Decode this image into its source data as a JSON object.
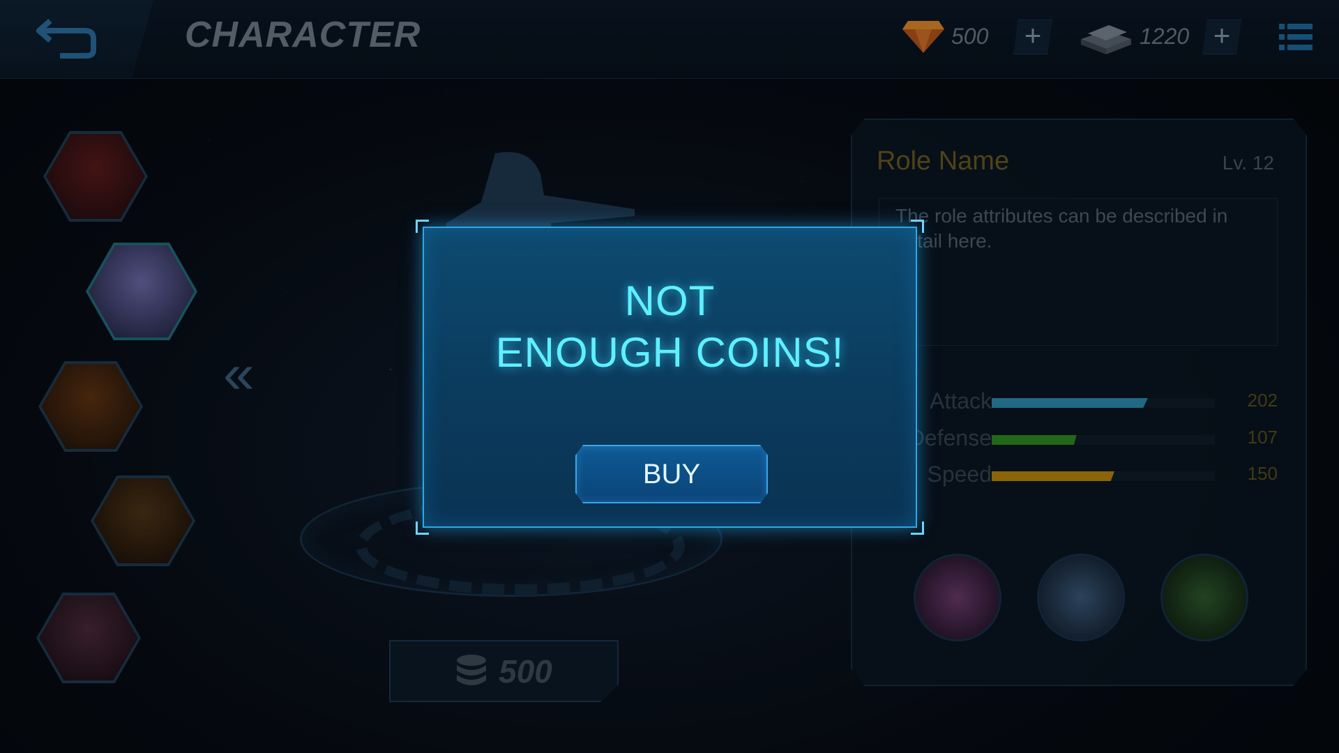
{
  "header": {
    "title": "CHARACTER",
    "gems": {
      "value": "500",
      "icon": "gem-icon"
    },
    "silver": {
      "value": "1220",
      "icon": "silver-bars-icon"
    },
    "plus_label": "+"
  },
  "character": {
    "price": "500",
    "price_icon": "coin-stack-icon"
  },
  "role": {
    "name": "Role Name",
    "level": "Lv. 12",
    "description": "The role attributes can be described in detail here.",
    "stats": [
      {
        "label": "Attack",
        "value": "202",
        "fraction": 0.7,
        "color": "#2b8bb0"
      },
      {
        "label": "Defense",
        "value": "107",
        "fraction": 0.38,
        "color": "#2f8a22"
      },
      {
        "label": "Speed",
        "value": "150",
        "fraction": 0.55,
        "color": "#b8860b"
      }
    ],
    "skills": [
      "burst-skill-icon",
      "orbit-skill-icon",
      "fist-skill-icon"
    ]
  },
  "avatars": [
    "avatar-red-hair",
    "avatar-purple-hair",
    "avatar-orange-hair",
    "avatar-spiky-hair",
    "avatar-pink-hair"
  ],
  "modal": {
    "line1": "NOT",
    "line2": "ENOUGH COINS!",
    "buy_label": "BUY"
  }
}
